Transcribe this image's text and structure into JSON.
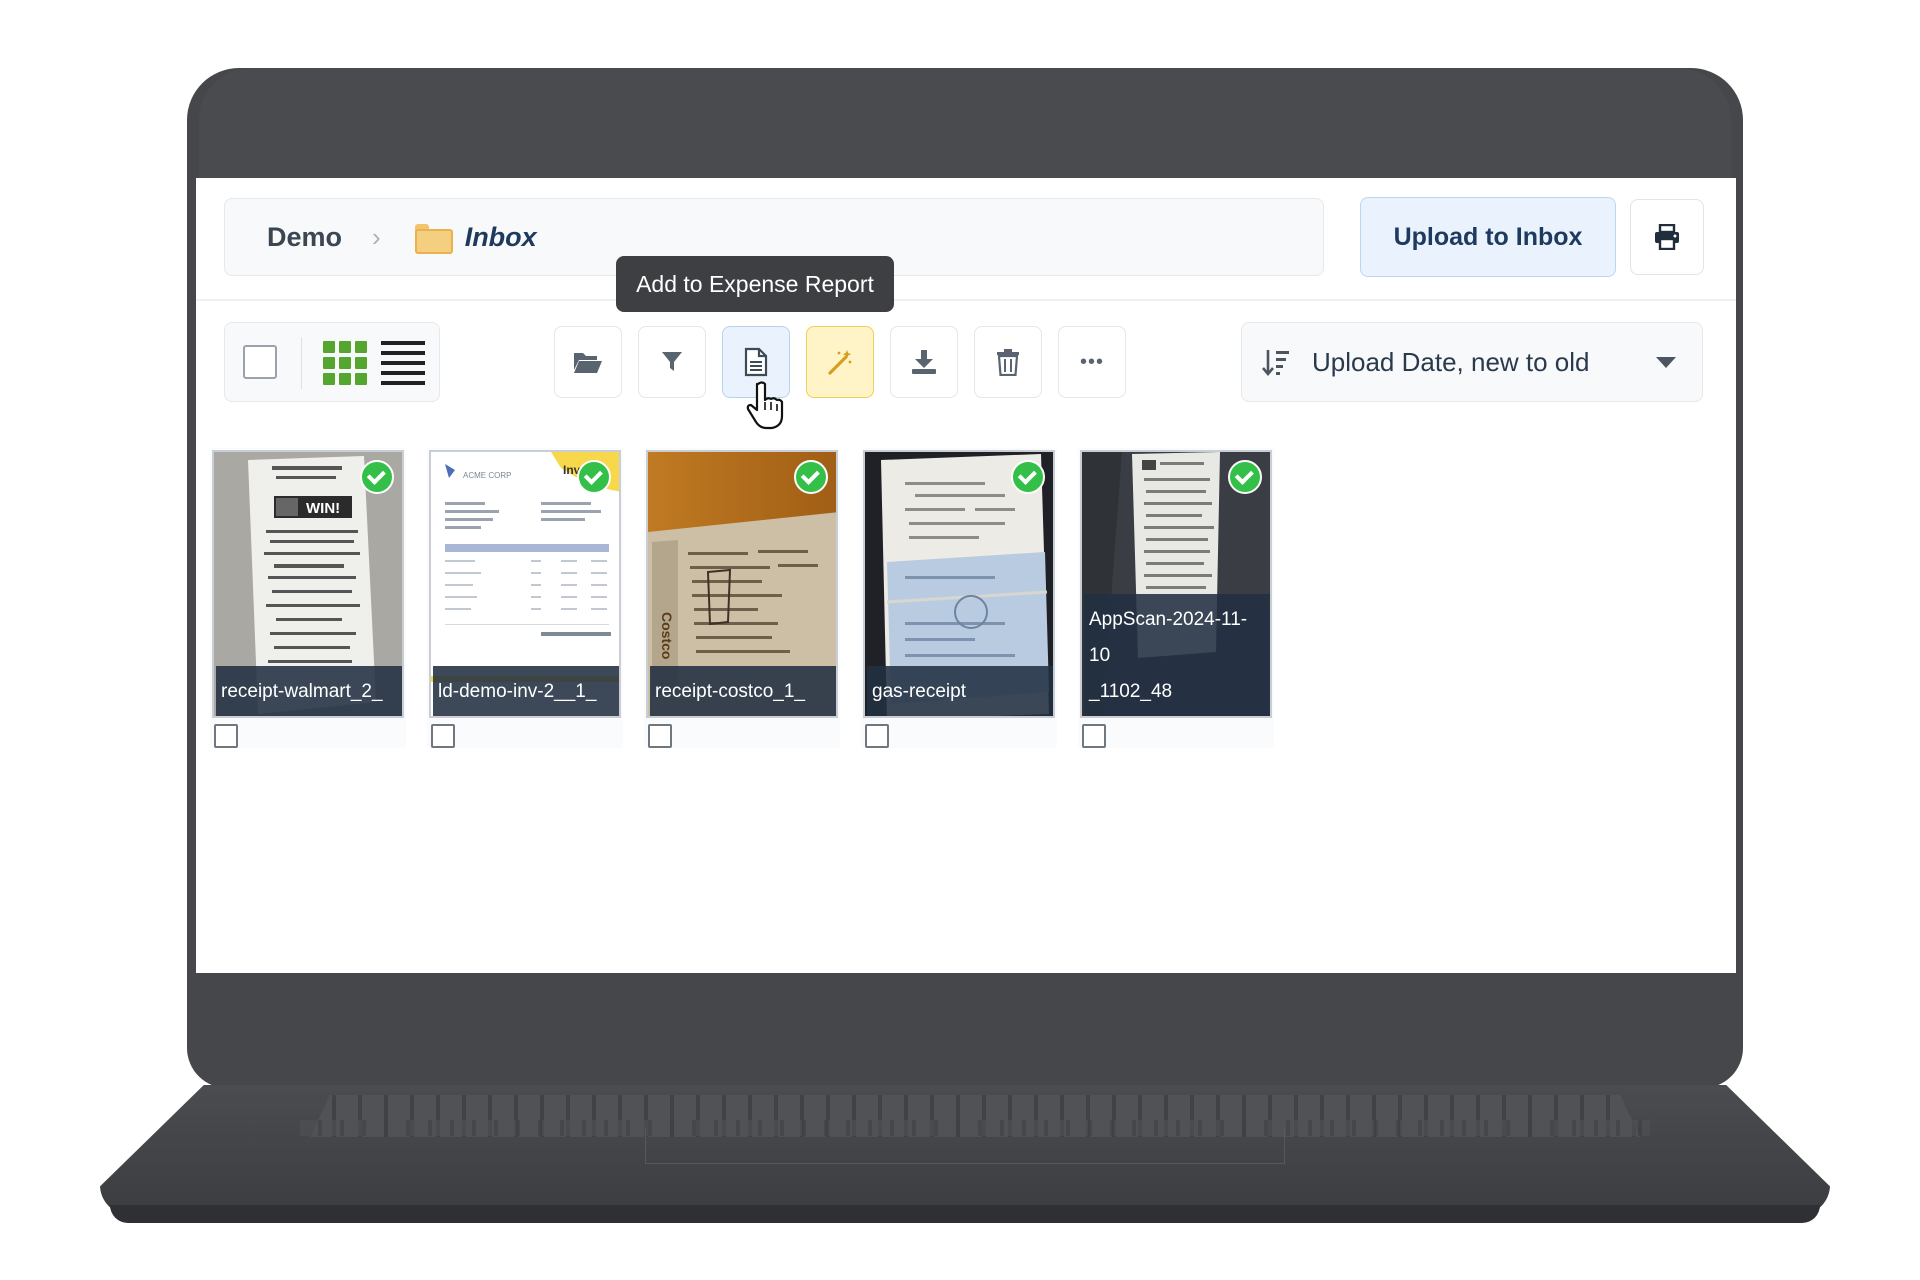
{
  "breadcrumb": {
    "root": "Demo",
    "separator": "›",
    "folder": "Inbox"
  },
  "header": {
    "upload_label": "Upload to Inbox"
  },
  "tooltip": {
    "text": "Add to Expense Report"
  },
  "toolbar": {
    "actions": [
      {
        "icon": "folder-open-icon"
      },
      {
        "icon": "filter-icon"
      },
      {
        "icon": "expense-report-icon"
      },
      {
        "icon": "magic-wand-icon"
      },
      {
        "icon": "download-icon"
      },
      {
        "icon": "trash-icon"
      },
      {
        "icon": "more-icon",
        "label": "•••"
      }
    ]
  },
  "sort": {
    "label": "Upload Date, new to old"
  },
  "files": [
    {
      "name": "receipt-walmart_2_",
      "checked": true
    },
    {
      "name": "ld-demo-inv-2__1_",
      "checked": true
    },
    {
      "name": "receipt-costco_1_",
      "checked": true
    },
    {
      "name": "gas-receipt",
      "checked": true
    },
    {
      "name": "AppScan-2024-11-10_1102_48",
      "name_line1": "AppScan-2024-11-10",
      "name_line2": "_1102_48",
      "checked": true
    }
  ],
  "colors": {
    "accent": "#1f3a5f",
    "grid_view": "#55a630",
    "status_ok": "#34c048",
    "magic": "#f0cf58"
  }
}
